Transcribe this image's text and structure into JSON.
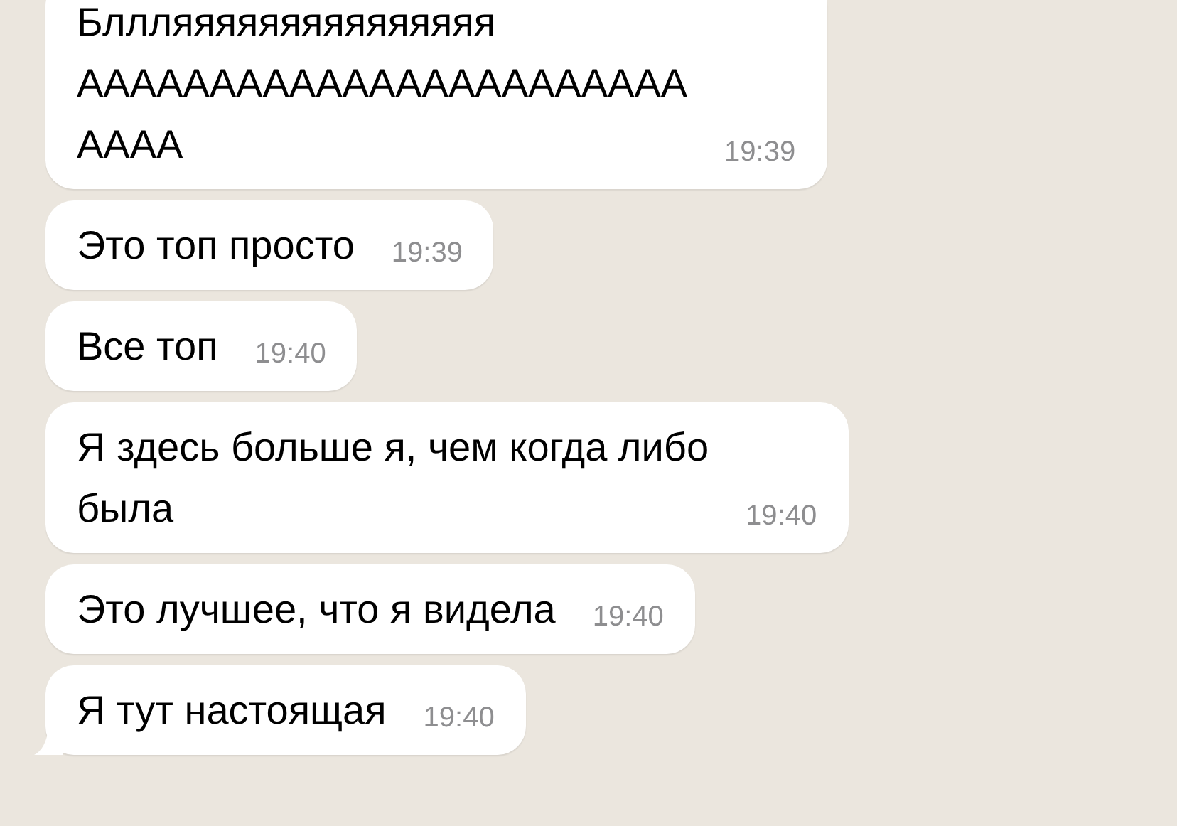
{
  "messages": [
    {
      "lines": [
        "Бллляяяяяяяяяяяяяяя",
        "ААААААААААААААААААААААА",
        "АААА"
      ],
      "time": "19:39",
      "tail": false
    },
    {
      "lines": [
        "Это топ просто"
      ],
      "time": "19:39",
      "tail": false
    },
    {
      "lines": [
        "Все топ"
      ],
      "time": "19:40",
      "tail": false
    },
    {
      "lines": [
        "Я здесь больше я, чем когда либо",
        "была"
      ],
      "time": "19:40",
      "tail": false
    },
    {
      "lines": [
        "Это лучшее, что я видела"
      ],
      "time": "19:40",
      "tail": false
    },
    {
      "lines": [
        "Я тут настоящая"
      ],
      "time": "19:40",
      "tail": true
    }
  ]
}
